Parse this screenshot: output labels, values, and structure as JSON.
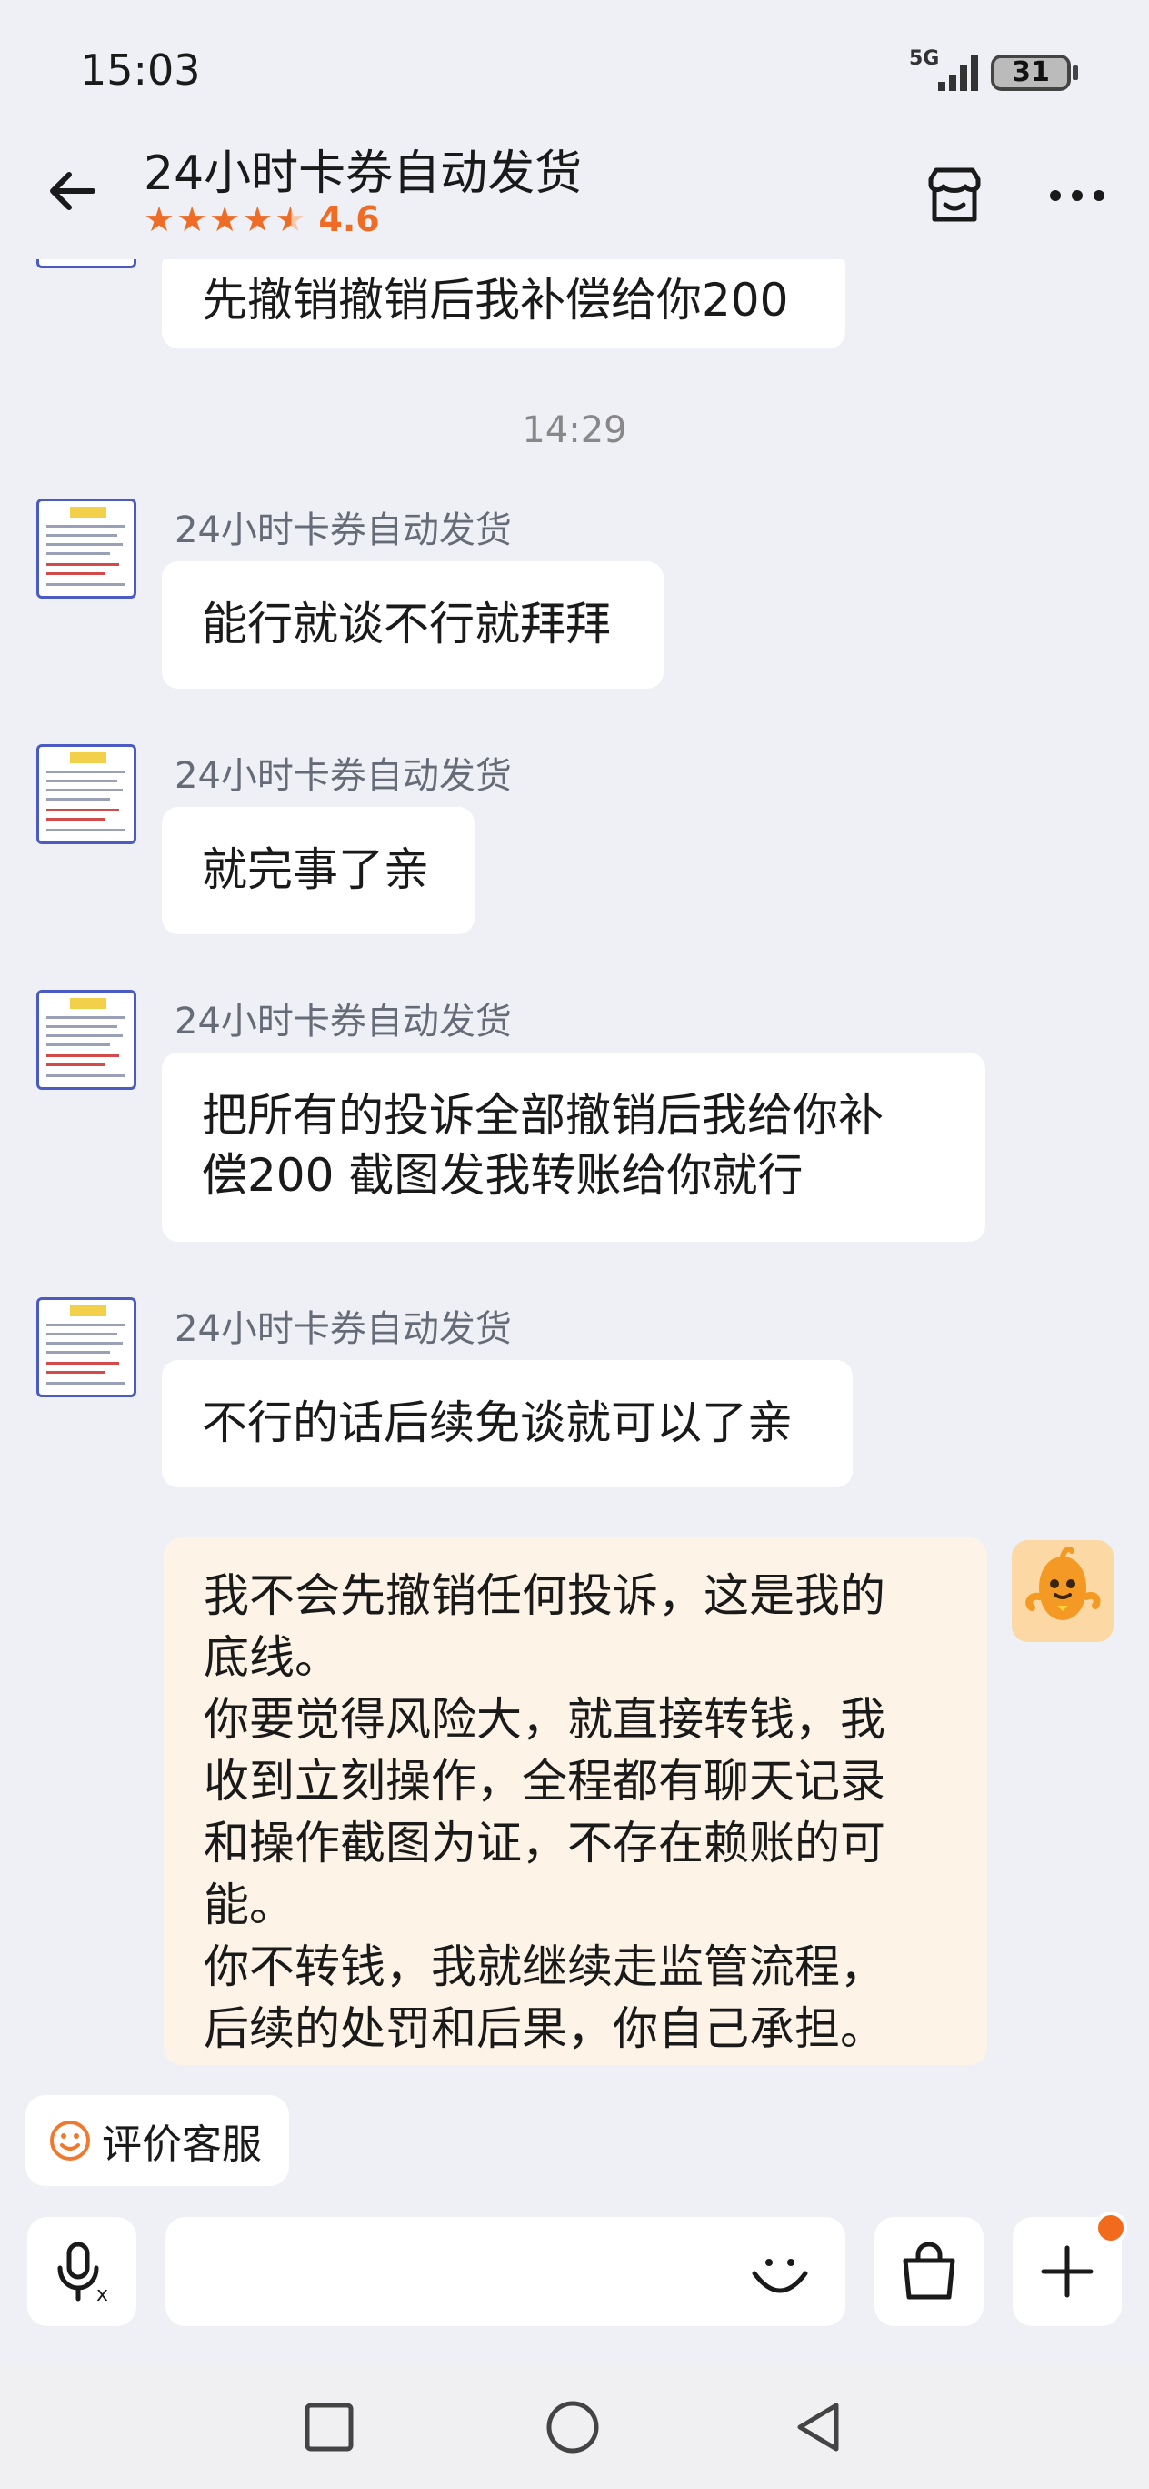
{
  "status_bar": {
    "time": "15:03",
    "network": "5G",
    "battery": "31"
  },
  "header": {
    "title": "24小时卡券自动发货",
    "rating_value": "4.6",
    "rating_stars": 4.5,
    "accent_color": "#ef6c27"
  },
  "chat": {
    "messages": [
      {
        "from": "shop",
        "text": "先撤销撤销后我补偿给你200"
      },
      {
        "type": "time",
        "text": "14:29"
      },
      {
        "from": "shop",
        "sender": "24小时卡券自动发货",
        "text": "能行就谈不行就拜拜"
      },
      {
        "from": "shop",
        "sender": "24小时卡券自动发货",
        "text": "就完事了亲"
      },
      {
        "from": "shop",
        "sender": "24小时卡券自动发货",
        "lines": [
          "把所有的投诉全部撤销后我给你补",
          "偿200 截图发我转账给你就行"
        ]
      },
      {
        "from": "shop",
        "sender": "24小时卡券自动发货",
        "text": "不行的话后续免谈就可以了亲"
      },
      {
        "from": "me",
        "lines": [
          "我不会先撤销任何投诉，这是我的",
          "底线。",
          "你要觉得风险大，就直接转钱，我",
          "收到立刻操作，全程都有聊天记录",
          "和操作截图为证，不存在赖账的可",
          "能。",
          "你不转钱，我就继续走监管流程，",
          "后续的处罚和后果，你自己承担。"
        ]
      }
    ]
  },
  "rate_service": {
    "label": "评价客服"
  },
  "input": {
    "placeholder": ""
  },
  "icons": {
    "back": "back-arrow-icon",
    "shop": "store-icon",
    "more": "more-icon",
    "voice": "voice-translate-icon",
    "emoji": "emoji-icon",
    "cart": "shopping-bag-icon",
    "add": "plus-icon",
    "rate": "smile-icon"
  }
}
